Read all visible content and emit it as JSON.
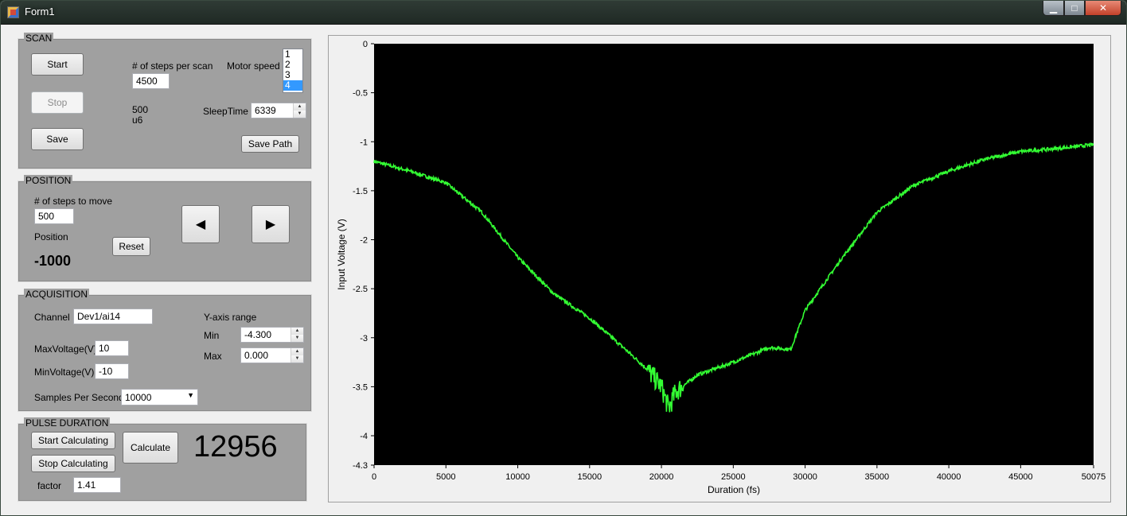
{
  "window": {
    "title": "Form1"
  },
  "scan": {
    "title": "SCAN",
    "start_label": "Start",
    "stop_label": "Stop",
    "save_label": "Save",
    "steps_label": "# of steps per scan",
    "steps_value": "4500",
    "motor_speed_label": "Motor speed",
    "motor_speed_options": [
      "1",
      "2",
      "3",
      "4"
    ],
    "motor_speed_selected": "4",
    "info_line1": "500",
    "info_line2": "u6",
    "sleep_label": "SleepTime",
    "sleep_value": "6339",
    "save_path_label": "Save Path"
  },
  "position": {
    "title": "POSITION",
    "steps_label": "# of steps to move",
    "steps_value": "500",
    "position_label": "Position",
    "position_value": "-1000",
    "reset_label": "Reset"
  },
  "acquisition": {
    "title": "ACQUISITION",
    "channel_label": "Channel",
    "channel_value": "Dev1/ai14",
    "max_voltage_label": "MaxVoltage(V)",
    "max_voltage_value": "10",
    "min_voltage_label": "MinVoltage(V)",
    "min_voltage_value": "-10",
    "samples_label": "Samples Per Second",
    "samples_value": "10000",
    "yaxis_label": "Y-axis range",
    "min_label": "Min",
    "min_value": "-4.300",
    "max_label": "Max",
    "max_value": "0.000"
  },
  "pulse": {
    "title": "PULSE DURATION",
    "start_calc_label": "Start Calculating",
    "stop_calc_label": "Stop Calculating",
    "calculate_label": "Calculate",
    "result": "12956",
    "factor_label": "factor",
    "factor_value": "1.41"
  },
  "chart_data": {
    "type": "line",
    "xlabel": "Duration (fs)",
    "ylabel": "Input Voltage (V)",
    "xlim": [
      0,
      50075
    ],
    "ylim": [
      -4.3,
      0
    ],
    "x_ticks": [
      "0",
      "5000",
      "10000",
      "15000",
      "20000",
      "25000",
      "30000",
      "35000",
      "40000",
      "45000",
      "50075"
    ],
    "y_ticks": [
      "0",
      "-0.5",
      "-1",
      "-1.5",
      "-2",
      "-2.5",
      "-3",
      "-3.5",
      "-4",
      "-4.3"
    ],
    "x_tick_values": [
      0,
      5000,
      10000,
      15000,
      20000,
      25000,
      30000,
      35000,
      40000,
      45000,
      50075
    ],
    "y_tick_values": [
      0,
      -0.5,
      -1,
      -1.5,
      -2,
      -2.5,
      -3,
      -3.5,
      -4,
      -4.3
    ],
    "background": "#000000",
    "line_color": "#33ff33",
    "series": [
      {
        "x": [
          0,
          2500,
          5000,
          7500,
          10000,
          12500,
          15000,
          17500,
          19000,
          20000,
          20500,
          21000,
          22500,
          25000,
          27500,
          29000,
          30000,
          32500,
          35000,
          37500,
          40000,
          42500,
          45000,
          47500,
          50075
        ],
        "y": [
          -1.2,
          -1.3,
          -1.42,
          -1.72,
          -2.18,
          -2.55,
          -2.8,
          -3.12,
          -3.32,
          -3.5,
          -3.72,
          -3.55,
          -3.38,
          -3.25,
          -3.1,
          -3.12,
          -2.72,
          -2.2,
          -1.72,
          -1.45,
          -1.3,
          -1.18,
          -1.1,
          -1.07,
          -1.03
        ]
      }
    ]
  }
}
